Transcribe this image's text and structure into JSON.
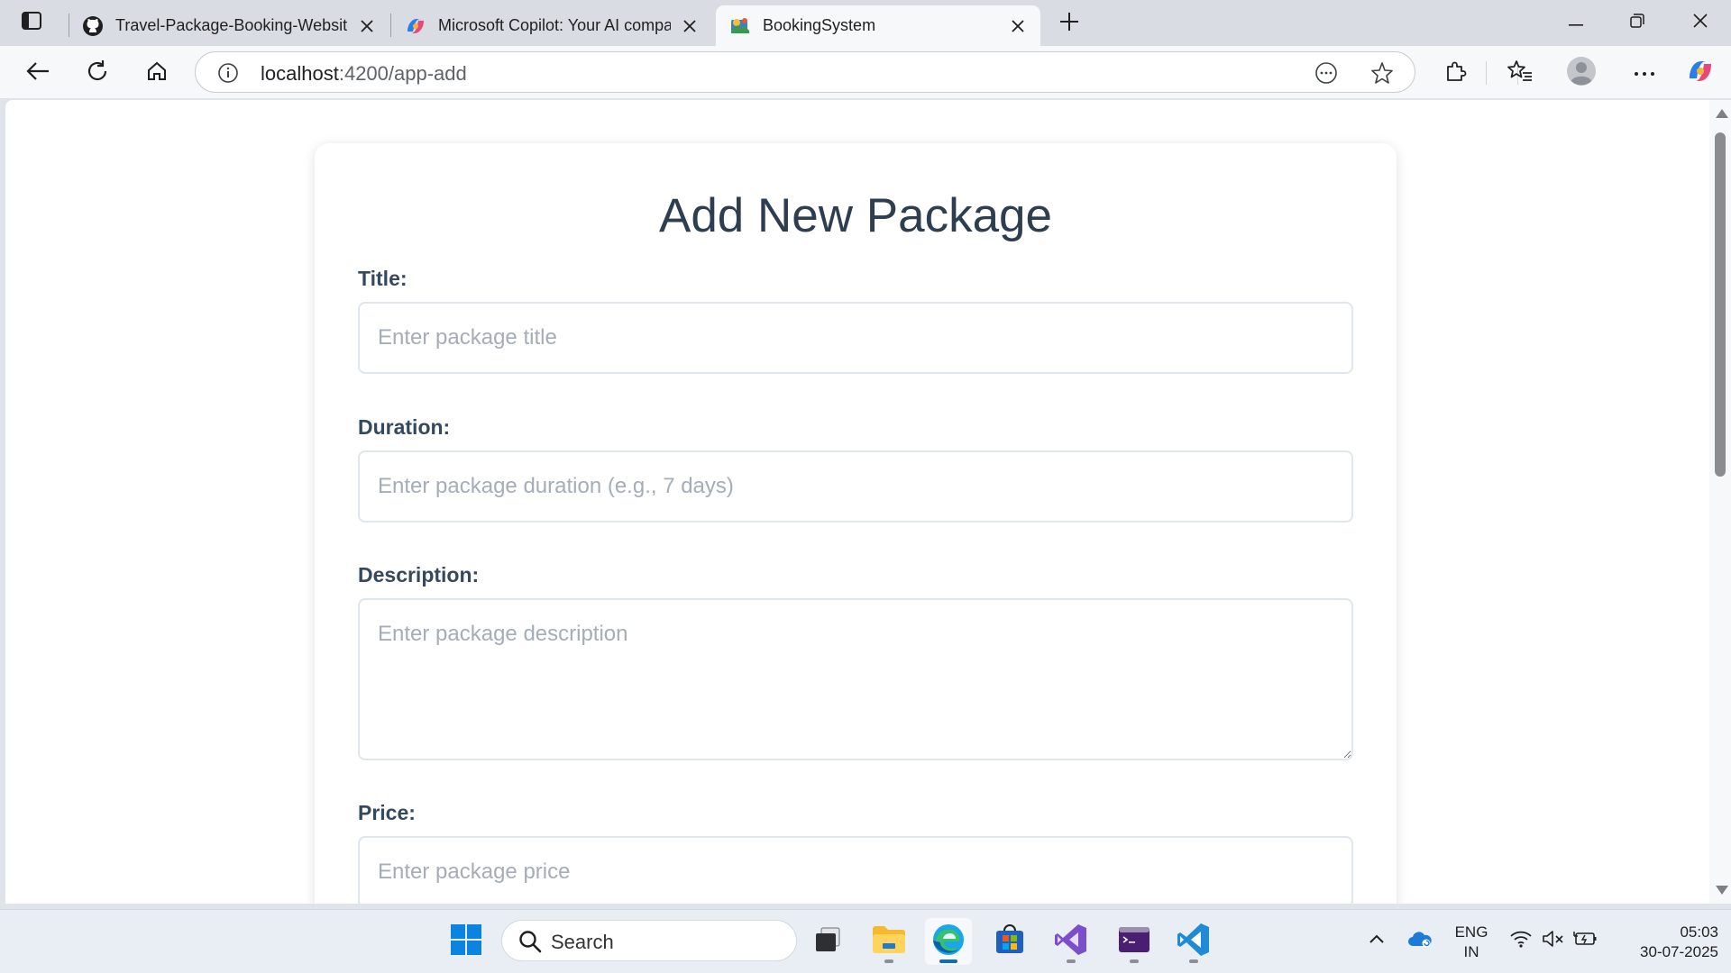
{
  "browser": {
    "tabs": [
      {
        "label": "Travel-Package-Booking-Website",
        "icon": "github-icon"
      },
      {
        "label": "Microsoft Copilot: Your AI companion",
        "icon": "copilot-icon"
      },
      {
        "label": "BookingSystem",
        "icon": "angular-app-icon",
        "active": true
      }
    ],
    "address": {
      "host": "localhost",
      "path": ":4200/app-add"
    }
  },
  "page": {
    "heading": "Add New Package",
    "fields": {
      "title": {
        "label": "Title:",
        "placeholder": "Enter package title",
        "value": ""
      },
      "duration": {
        "label": "Duration:",
        "placeholder": "Enter package duration (e.g., 7 days)",
        "value": ""
      },
      "description": {
        "label": "Description:",
        "placeholder": "Enter package description",
        "value": ""
      },
      "price": {
        "label": "Price:",
        "placeholder": "Enter package price",
        "value": ""
      }
    }
  },
  "taskbar": {
    "search_label": "Search",
    "language": {
      "line1": "ENG",
      "line2": "IN"
    },
    "time": "05:03",
    "date": "30-07-2025"
  },
  "colors": {
    "heading": "#2c3e50",
    "label": "#34495e",
    "input_border": "#dfe6ee",
    "placeholder": "#a4adb8",
    "edge_accent": "#0f6cbd"
  }
}
